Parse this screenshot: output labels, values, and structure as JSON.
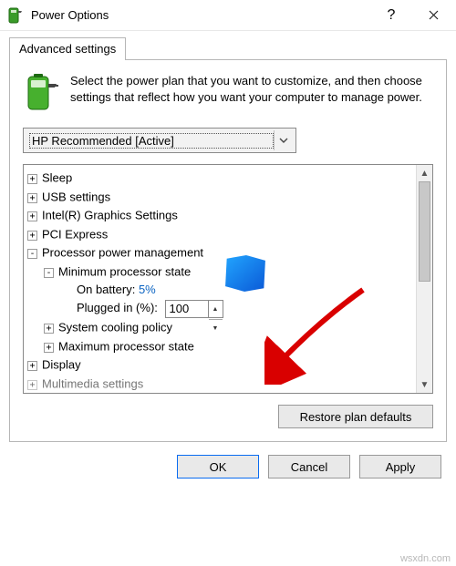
{
  "window": {
    "title": "Power Options"
  },
  "tab": {
    "label": "Advanced settings"
  },
  "intro": "Select the power plan that you want to customize, and then choose settings that reflect how you want your computer to manage power.",
  "plan": {
    "selected": "HP Recommended [Active]"
  },
  "tree": {
    "sleep": "Sleep",
    "usb": "USB settings",
    "gfx": "Intel(R) Graphics Settings",
    "pci": "PCI Express",
    "ppm": "Processor power management",
    "minstate": "Minimum processor state",
    "on_battery_label": "On battery:",
    "on_battery_value": "5%",
    "plugged_label": "Plugged in (%):",
    "plugged_value": "100",
    "cooling": "System cooling policy",
    "maxstate": "Maximum processor state",
    "display": "Display",
    "multimedia": "Multimedia settings"
  },
  "buttons": {
    "restore": "Restore plan defaults",
    "ok": "OK",
    "cancel": "Cancel",
    "apply": "Apply"
  },
  "watermark": "wsxdn.com"
}
